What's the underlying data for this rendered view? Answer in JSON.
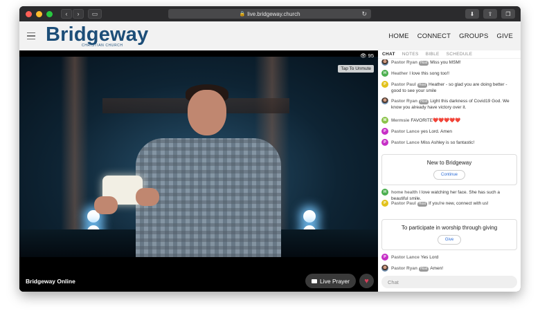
{
  "browser": {
    "url": "live.bridgeway.church",
    "traffic_colors": {
      "close": "#ff5f57",
      "minimize": "#febc2e",
      "zoom": "#28c840"
    }
  },
  "header": {
    "logo_text": "Bridgeway",
    "logo_sub": "CHRISTIAN CHURCH",
    "brand_color": "#1d4e78",
    "nav": [
      "HOME",
      "CONNECT",
      "GROUPS",
      "GIVE"
    ]
  },
  "video": {
    "viewer_count": "95",
    "unmute_label": "Tap To Unmute",
    "title": "Bridgeway Online",
    "live_prayer_label": "Live Prayer"
  },
  "panel": {
    "tabs": [
      "CHAT",
      "NOTES",
      "BIBLE",
      "SCHEDULE"
    ],
    "chat": [
      {
        "initial": "",
        "avatar": "photo",
        "color": "",
        "name": "Pastor Ryan",
        "host": true,
        "text": "Miss you MSM!"
      },
      {
        "initial": "H",
        "avatar": "letter",
        "color": "#4caf50",
        "name": "Heather",
        "host": false,
        "text": "I love this song too!!"
      },
      {
        "initial": "P",
        "avatar": "letter",
        "color": "#e2c21b",
        "name": "Pastor Paul",
        "host": true,
        "text": "Heather - so glad you are doing better - good to see your smile"
      },
      {
        "initial": "",
        "avatar": "photo",
        "color": "",
        "name": "Pastor Ryan",
        "host": true,
        "text": "Light this darkness of Covid19 God. We know you already have victory over it."
      },
      {
        "initial": "M",
        "avatar": "letter",
        "color": "#8bc34a",
        "name": "Mermsie",
        "host": false,
        "text": "FAVORITE❤️❤️❤️❤️❤️"
      },
      {
        "initial": "P",
        "avatar": "letter",
        "color": "#c62fc6",
        "name": "Pastor Lance",
        "host": false,
        "text": "yes Lord. Amen"
      },
      {
        "initial": "P",
        "avatar": "letter",
        "color": "#c62fc6",
        "name": "Pastor Lance",
        "host": false,
        "text": "Miss Ashley is so fantastic!"
      },
      {
        "initial": "H",
        "avatar": "letter",
        "color": "#4caf50",
        "name": "home health",
        "host": false,
        "text": "I love watching her face. She has such a beautiful smile."
      },
      {
        "initial": "P",
        "avatar": "letter",
        "color": "#e2c21b",
        "name": "Pastor Paul",
        "host": true,
        "text": "If you're new, connect with us!"
      },
      {
        "initial": "P",
        "avatar": "letter",
        "color": "#c62fc6",
        "name": "Pastor Lance",
        "host": false,
        "text": "Yes Lord"
      },
      {
        "initial": "",
        "avatar": "photo",
        "color": "",
        "name": "Pastor Ryan",
        "host": true,
        "text": "Amen!"
      }
    ],
    "host_badge": "Host",
    "card_new": {
      "title": "New to Bridgeway",
      "button": "Continue"
    },
    "card_give": {
      "title": "To participate in worship through giving",
      "button": "Give"
    },
    "chat_placeholder": "Chat"
  }
}
